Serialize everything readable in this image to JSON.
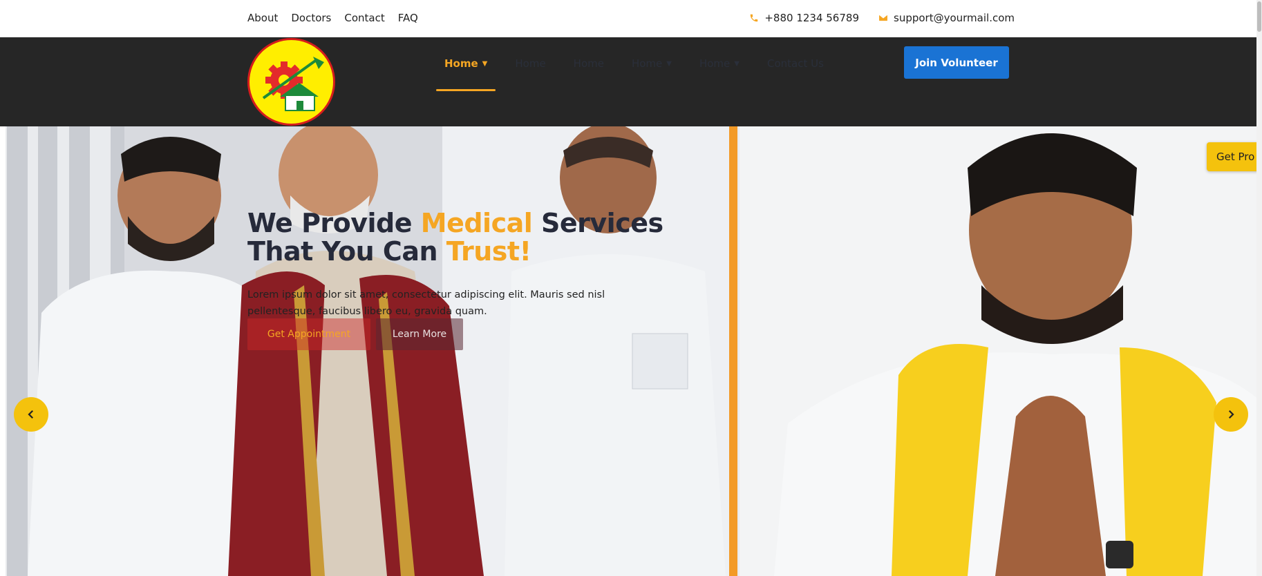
{
  "topbar": {
    "links": [
      "About",
      "Doctors",
      "Contact",
      "FAQ"
    ],
    "phone": "+880 1234 56789",
    "email": "support@yourmail.com"
  },
  "nav": {
    "items": [
      {
        "label": "Home",
        "active": true,
        "has_dropdown": true
      },
      {
        "label": "Home",
        "active": false,
        "has_dropdown": false
      },
      {
        "label": "Home",
        "active": false,
        "has_dropdown": false
      },
      {
        "label": "Home",
        "active": false,
        "has_dropdown": true
      },
      {
        "label": "Home",
        "active": false,
        "has_dropdown": true
      },
      {
        "label": "Contact Us",
        "active": false,
        "has_dropdown": false
      }
    ],
    "cta": "Join Volunteer"
  },
  "hero": {
    "title_line1_a": "We Provide ",
    "title_line1_hl": "Medical",
    "title_line1_b": " Services",
    "title_line2_a": "That You Can ",
    "title_line2_hl": "Trust!",
    "description": "Lorem ipsum dolor sit amet, consectetur adipiscing elit. Mauris sed nisl pellentesque, faucibus libero eu, gravida quam.",
    "btn_primary": "Get Appointment",
    "btn_secondary": "Learn More"
  },
  "floating": {
    "get_pro": "Get Pro"
  },
  "colors": {
    "accent": "#f5a623",
    "navbar": "#262626",
    "cta": "#1a73d4",
    "arrow": "#f4c20d"
  }
}
